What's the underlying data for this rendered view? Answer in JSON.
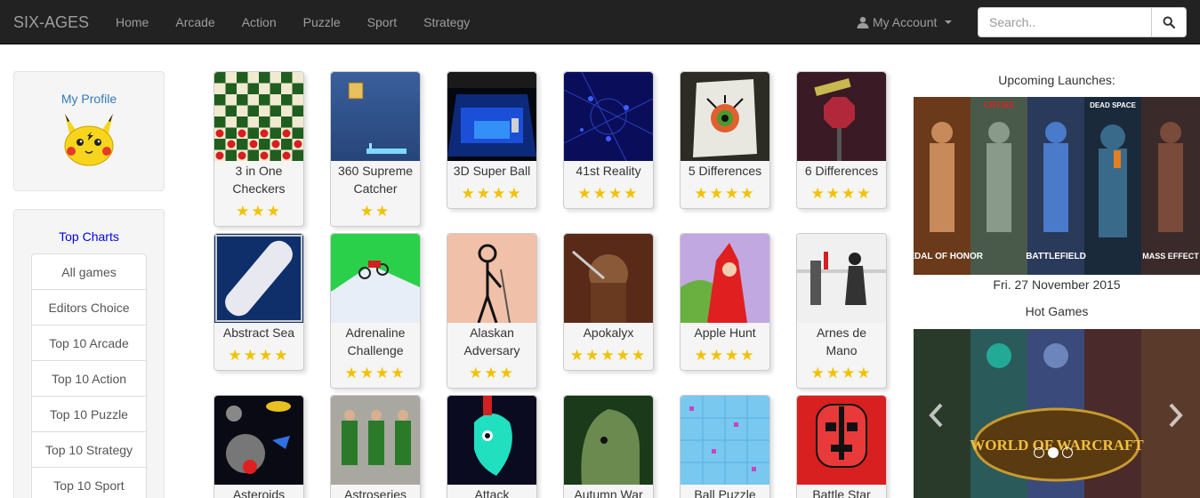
{
  "navbar": {
    "brand": "SIX-AGES",
    "links": [
      "Home",
      "Arcade",
      "Action",
      "Puzzle",
      "Sport",
      "Strategy"
    ],
    "account_label": "My Account",
    "search_placeholder": "Search.."
  },
  "profile": {
    "title": "My Profile",
    "avatar_icon": "pikachu-avatar"
  },
  "charts": {
    "title": "Top Charts",
    "items": [
      "All games",
      "Editors Choice",
      "Top 10 Arcade",
      "Top 10 Action",
      "Top 10 Puzzle",
      "Top 10 Strategy",
      "Top 10 Sport"
    ]
  },
  "games": [
    {
      "name": "3 in One Checkers",
      "stars": "★★★"
    },
    {
      "name": "360 Supreme Catcher",
      "stars": "★★"
    },
    {
      "name": "3D Super Ball",
      "stars": "★★★★"
    },
    {
      "name": "41st Reality",
      "stars": "★★★★"
    },
    {
      "name": "5 Differences",
      "stars": "★★★★"
    },
    {
      "name": "6 Differences",
      "stars": "★★★★"
    },
    {
      "name": "Abstract Sea",
      "stars": "★★★★"
    },
    {
      "name": "Adrenaline Challenge",
      "stars": "★★★★"
    },
    {
      "name": "Alaskan Adversary",
      "stars": "★★★"
    },
    {
      "name": "Apokalyx",
      "stars": "★★★★★"
    },
    {
      "name": "Apple Hunt",
      "stars": "★★★★"
    },
    {
      "name": "Arnes de Mano",
      "stars": "★★★★"
    },
    {
      "name": "Asteroids",
      "stars": ""
    },
    {
      "name": "Astroseries",
      "stars": ""
    },
    {
      "name": "Attack",
      "stars": ""
    },
    {
      "name": "Autumn War",
      "stars": ""
    },
    {
      "name": "Ball Puzzle",
      "stars": ""
    },
    {
      "name": "Battle Star",
      "stars": ""
    }
  ],
  "right": {
    "upcoming_title": "Upcoming Launches:",
    "upcoming_date": "Fri. 27 November 2015",
    "upcoming_labels": [
      "MEDAL OF HONOR",
      "CRYSIS",
      "BATTLEFIELD",
      "DEAD SPACE",
      "MASS EFFECT"
    ],
    "hot_title": "Hot Games",
    "hot_logo": "WORLD OF WARCRAFT"
  }
}
